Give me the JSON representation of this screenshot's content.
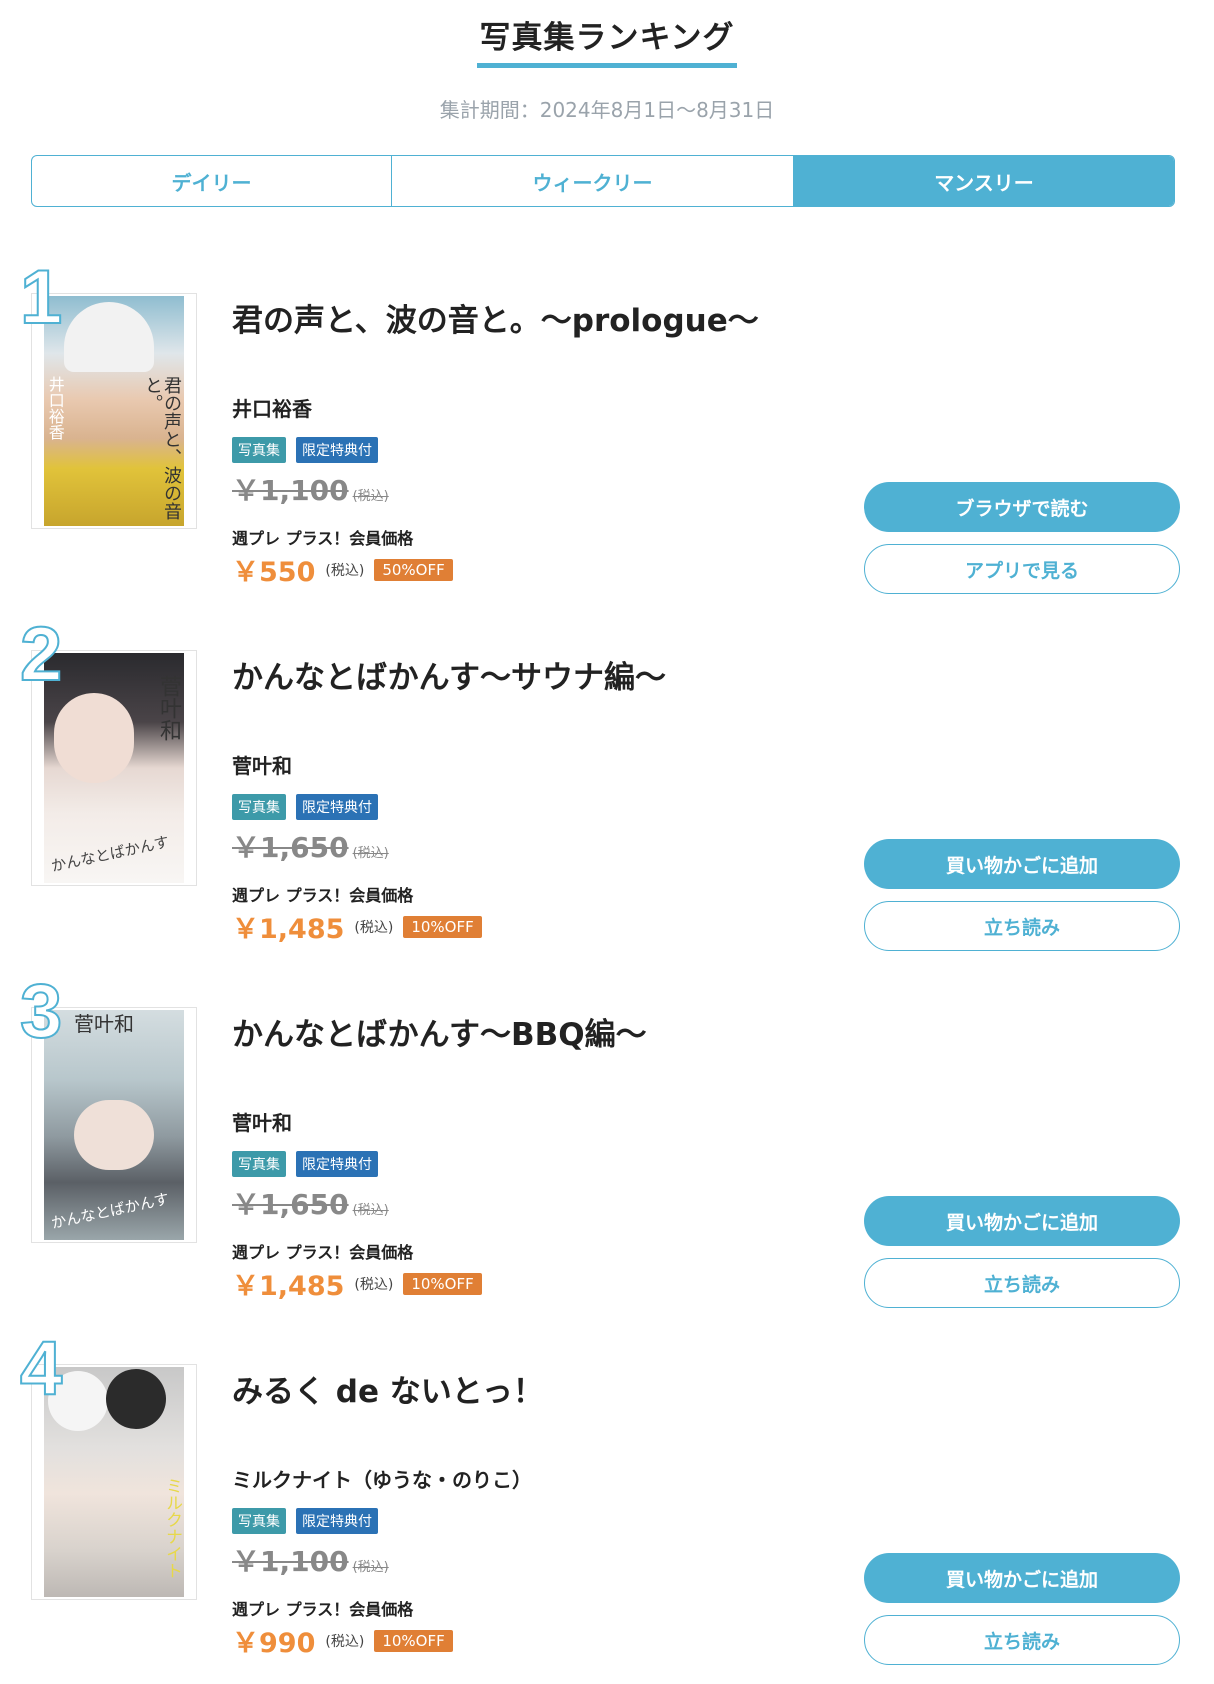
{
  "header": {
    "title": "写真集ランキング",
    "period": "集計期間：2024年8月1日〜8月31日"
  },
  "tabs": [
    {
      "label": "デイリー",
      "active": false
    },
    {
      "label": "ウィークリー",
      "active": false
    },
    {
      "label": "マンスリー",
      "active": true
    }
  ],
  "items": [
    {
      "rank": "1",
      "title": "君の声と、波の音と。〜prologue〜",
      "author": "井口裕香",
      "badges": [
        "写真集",
        "限定特典付"
      ],
      "list_price": "￥1,100",
      "tax_label": "(税込)",
      "member_label": "週プレ プラス！会員価格",
      "member_price": "￥550",
      "discount": "50%OFF",
      "cover_text": "君の声と、波の音と。",
      "cover_name": "井口裕香",
      "buttons": {
        "primary": "ブラウザで読む",
        "secondary": "アプリで見る"
      }
    },
    {
      "rank": "2",
      "title": "かんなとばかんす〜サウナ編〜",
      "author": "菅叶和",
      "badges": [
        "写真集",
        "限定特典付"
      ],
      "list_price": "￥1,650",
      "tax_label": "(税込)",
      "member_label": "週プレ プラス！会員価格",
      "member_price": "￥1,485",
      "discount": "10%OFF",
      "cover_text": "かんなとばかんす",
      "cover_name": "菅叶和",
      "buttons": {
        "primary": "買い物かごに追加",
        "secondary": "立ち読み"
      }
    },
    {
      "rank": "3",
      "title": "かんなとばかんす〜BBQ編〜",
      "author": "菅叶和",
      "badges": [
        "写真集",
        "限定特典付"
      ],
      "list_price": "￥1,650",
      "tax_label": "(税込)",
      "member_label": "週プレ プラス！会員価格",
      "member_price": "￥1,485",
      "discount": "10%OFF",
      "cover_text": "かんなとばかんす",
      "cover_name": "菅叶和",
      "buttons": {
        "primary": "買い物かごに追加",
        "secondary": "立ち読み"
      }
    },
    {
      "rank": "4",
      "title": "みるく de ないとっ！",
      "author": "ミルクナイト（ゆうな・のりこ）",
      "badges": [
        "写真集",
        "限定特典付"
      ],
      "list_price": "￥1,100",
      "tax_label": "(税込)",
      "member_label": "週プレ プラス！会員価格",
      "member_price": "￥990",
      "discount": "10%OFF",
      "cover_text": "ミルクナイト",
      "cover_name": "",
      "buttons": {
        "primary": "買い物かごに追加",
        "secondary": "立ち読み"
      }
    }
  ],
  "colors": {
    "accent": "#4fb1d3",
    "price": "#ef8e3b",
    "discount_bg": "#e07f35",
    "badge_photobook": "#3d9aa9",
    "badge_bonus": "#2b72b5"
  }
}
